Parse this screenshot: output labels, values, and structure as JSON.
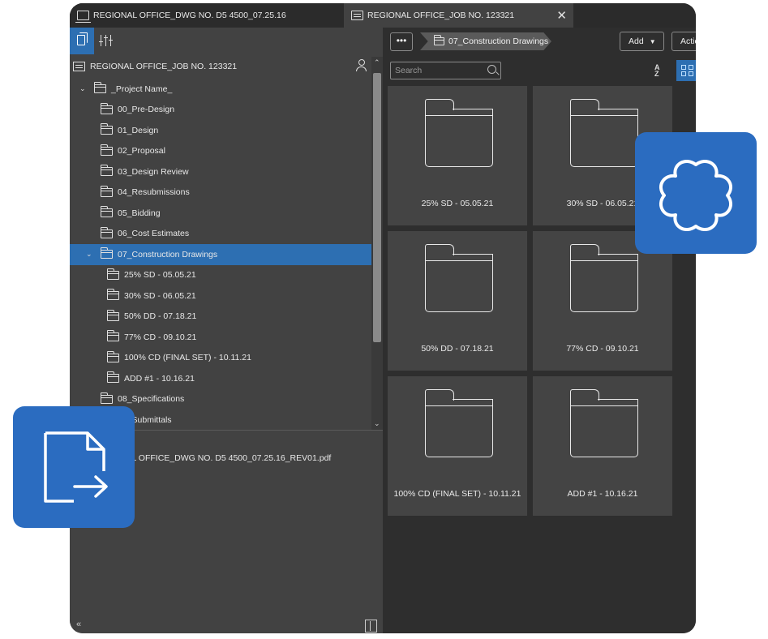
{
  "tabs": [
    {
      "title": "REGIONAL OFFICE_DWG NO. D5 4500_07.25.16",
      "active": false
    },
    {
      "title": "REGIONAL OFFICE_JOB NO. 123321",
      "active": true,
      "close": "✕"
    }
  ],
  "left_panel": {
    "project_header": "REGIONAL OFFICE_JOB NO. 123321",
    "tree": [
      {
        "label": "_Project Name_",
        "level": 0,
        "expanded": true
      },
      {
        "label": "00_Pre-Design",
        "level": 1
      },
      {
        "label": "01_Design",
        "level": 1
      },
      {
        "label": "02_Proposal",
        "level": 1
      },
      {
        "label": "03_Design Review",
        "level": 1
      },
      {
        "label": "04_Resubmissions",
        "level": 1
      },
      {
        "label": "05_Bidding",
        "level": 1
      },
      {
        "label": "06_Cost Estimates",
        "level": 1
      },
      {
        "label": "07_Construction Drawings",
        "level": 1,
        "expanded": true,
        "selected": true
      },
      {
        "label": "25% SD - 05.05.21",
        "level": 2
      },
      {
        "label": "30% SD - 06.05.21",
        "level": 2
      },
      {
        "label": "50% DD - 07.18.21",
        "level": 2
      },
      {
        "label": "77% CD - 09.10.21",
        "level": 2
      },
      {
        "label": "100% CD (FINAL SET) - 10.11.21",
        "level": 2
      },
      {
        "label": "ADD #1 - 10.16.21",
        "level": 2
      },
      {
        "label": "08_Specifications",
        "level": 1
      },
      {
        "label": "09_Submittals",
        "level": 1
      }
    ],
    "file_label": "REGIONAL OFFICE_DWG NO. D5 4500_07.25.16_REV01.pdf",
    "collapse_left": "«"
  },
  "right_panel": {
    "more_label": "•••",
    "breadcrumb": "07_Construction Drawings",
    "add_label": "Add",
    "actions_label": "Actions",
    "search_placeholder": "Search",
    "folders": [
      "25% SD - 05.05.21",
      "30% SD - 06.05.21",
      "50% DD - 07.18.21",
      "77% CD - 09.10.21",
      "100% CD (FINAL SET) - 10.11.21",
      "ADD #1 - 10.16.21"
    ]
  },
  "colors": {
    "accent": "#2d6fb2",
    "badge": "#2b6cc0",
    "panel_dark": "#2e2e2e",
    "panel_mid": "#424242"
  },
  "icons": {
    "export_badge": "file-export-icon",
    "flower_badge": "flower-icon"
  }
}
